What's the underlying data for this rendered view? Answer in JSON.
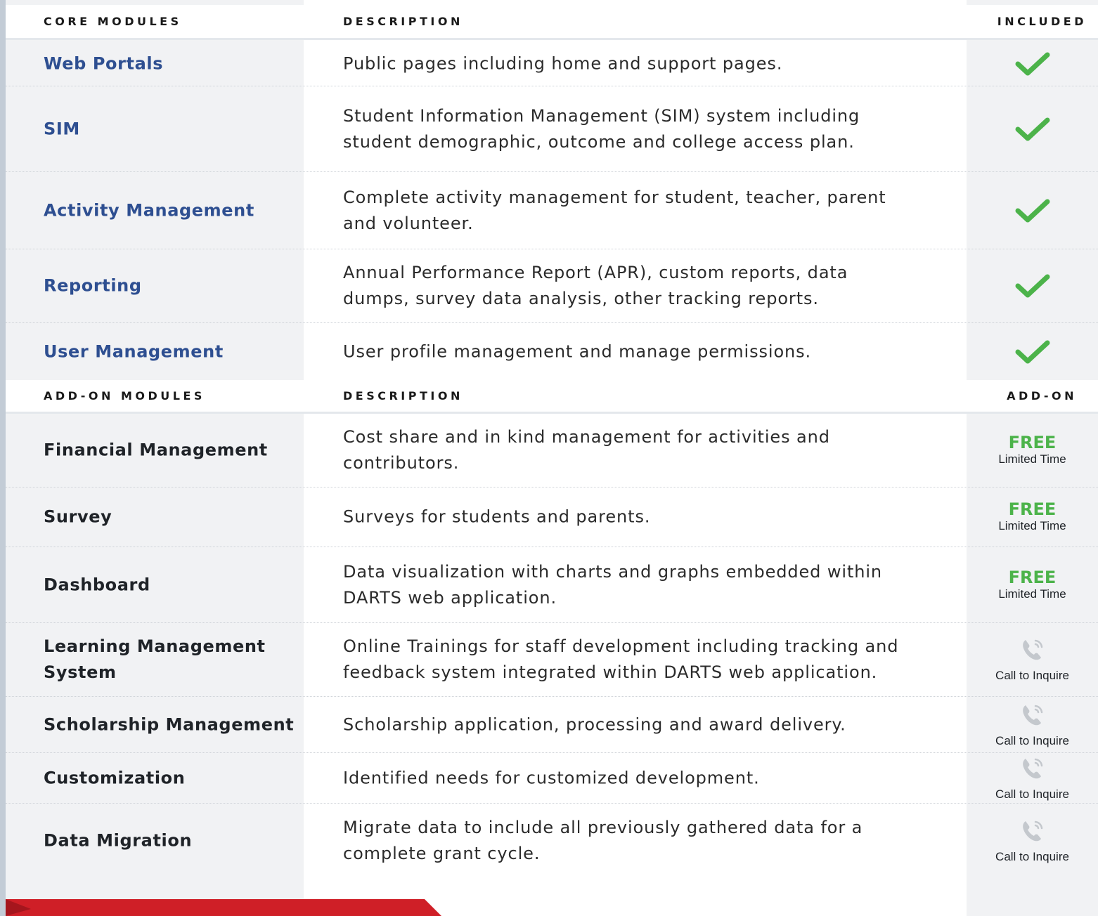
{
  "core_header": {
    "module": "CORE MODULES",
    "description": "DESCRIPTION",
    "status": "INCLUDED"
  },
  "core_rows": [
    {
      "name": "Web Portals",
      "description": "Public pages including home and support pages."
    },
    {
      "name": "SIM",
      "description": "Student Information Management (SIM) system including student demographic, outcome and college access plan."
    },
    {
      "name": "Activity Management",
      "description": "Complete activity management for student, teacher, parent and volunteer."
    },
    {
      "name": "Reporting",
      "description": "Annual Performance Report (APR), custom reports, data dumps, survey data analysis, other tracking reports."
    },
    {
      "name": "User Management",
      "description": "User profile management and manage permissions."
    }
  ],
  "addon_header": {
    "module": "ADD-ON MODULES",
    "description": "DESCRIPTION",
    "status": "ADD-ON"
  },
  "addon_rows": [
    {
      "name": "Financial Management",
      "description": "Cost share and in kind management for activities and contributors.",
      "status_main": "FREE",
      "status_sub": "Limited Time",
      "status_type": "free"
    },
    {
      "name": "Survey",
      "description": "Surveys for students and parents.",
      "status_main": "FREE",
      "status_sub": "Limited Time",
      "status_type": "free"
    },
    {
      "name": "Dashboard",
      "description": "Data visualization with charts and graphs embedded within DARTS web application.",
      "status_main": "FREE",
      "status_sub": "Limited Time",
      "status_type": "free"
    },
    {
      "name": "Learning Management System",
      "description": "Online Trainings for staff development including tracking and feedback system integrated within DARTS web application.",
      "status_sub": "Call to Inquire",
      "status_type": "call"
    },
    {
      "name": "Scholarship Management",
      "description": "Scholarship application, processing and award delivery.",
      "status_sub": "Call to Inquire",
      "status_type": "call"
    },
    {
      "name": "Customization",
      "description": "Identified needs for customized development.",
      "status_sub": "Call to Inquire",
      "status_type": "call"
    },
    {
      "name": "Data Migration",
      "description": "Migrate data to include all previously gathered data for a complete grant cycle.",
      "status_sub": "Call to Inquire",
      "status_type": "call"
    }
  ],
  "icons": {
    "included": "checkmark-icon",
    "call": "phone-icon"
  },
  "colors": {
    "core_name": "#2e4f91",
    "free": "#4cb34a",
    "check": "#4cb34a",
    "banner": "#cf1f27",
    "phone": "#c4c8cd"
  }
}
